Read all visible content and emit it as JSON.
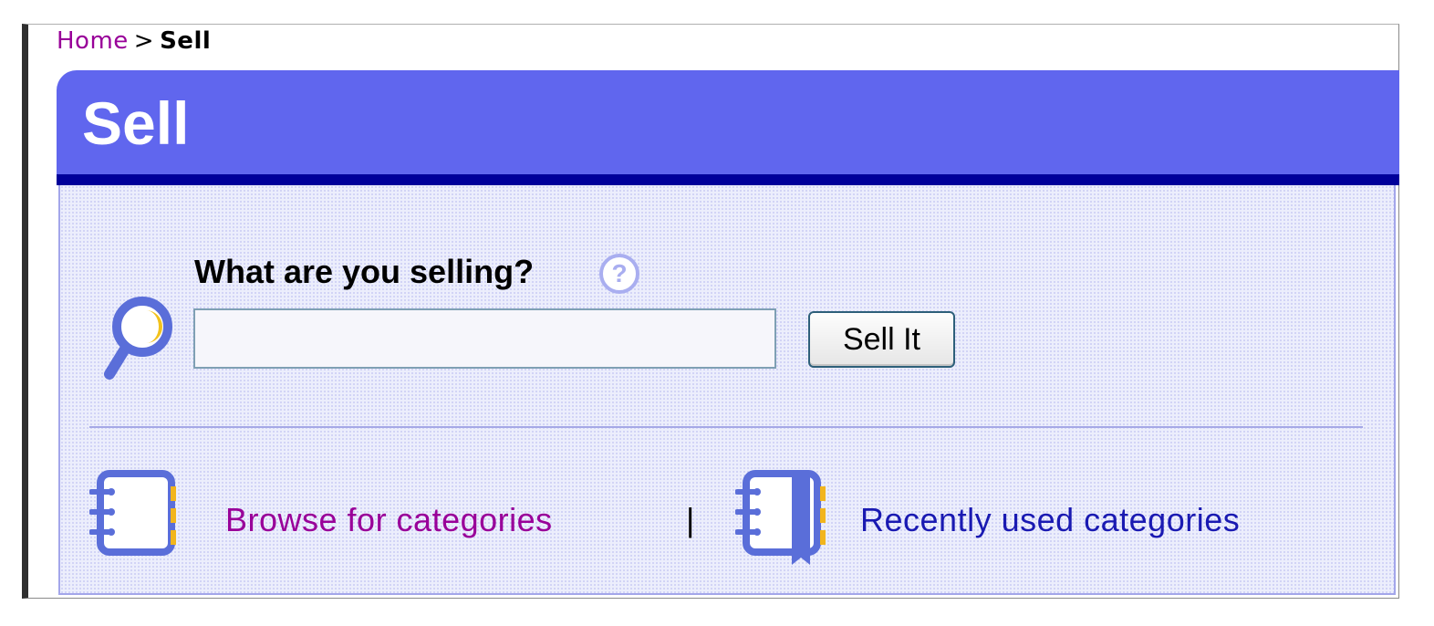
{
  "breadcrumb": {
    "home": "Home",
    "separator": ">",
    "current": "Sell"
  },
  "header": {
    "title": "Sell"
  },
  "form": {
    "question": "What are you selling?",
    "input_value": "",
    "sell_button_label": "Sell It"
  },
  "links": {
    "browse": "Browse for categories",
    "separator": "|",
    "recent": "Recently used categories"
  },
  "icons": {
    "help": "help-icon",
    "search": "magnifier-icon",
    "browse": "notebook-icon",
    "recent": "notebook-bookmark-icon"
  },
  "colors": {
    "header_bg": "#6066ee",
    "header_rule": "#00009a",
    "panel_bg": "#eceefc",
    "visited_link": "#990099",
    "link": "#1a1ab2"
  }
}
